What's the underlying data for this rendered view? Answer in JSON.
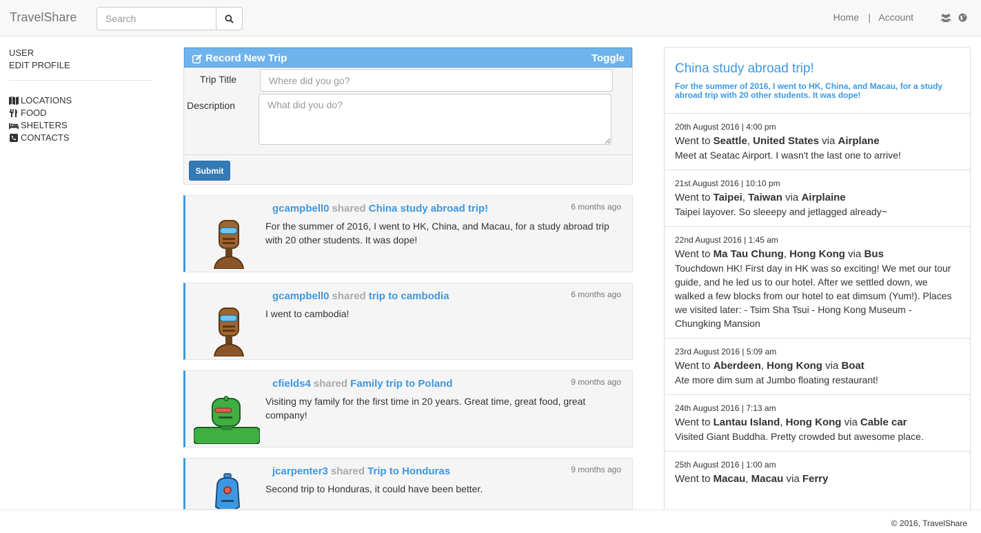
{
  "navbar": {
    "brand": "TravelShare",
    "search_placeholder": "Search",
    "home_label": "Home",
    "separator": "|",
    "account_label": "Account",
    "icons": [
      "users-icon",
      "globe-icon"
    ]
  },
  "sidebar": {
    "top_items": [
      {
        "label": "USER"
      },
      {
        "label": "EDIT PROFILE"
      }
    ],
    "items": [
      {
        "label": "LOCATIONS",
        "icon": "map-icon"
      },
      {
        "label": "FOOD",
        "icon": "cutlery-icon"
      },
      {
        "label": "SHELTERS",
        "icon": "bed-icon"
      },
      {
        "label": "CONTACTS",
        "icon": "phone-icon"
      }
    ]
  },
  "record": {
    "title": "Record New Trip",
    "toggle_label": "Toggle",
    "trip_title_label": "Trip Title",
    "trip_title_placeholder": "Where did you go?",
    "description_label": "Description",
    "description_placeholder": "What did you do?",
    "submit_label": "Submit"
  },
  "feed": [
    {
      "user": "gcampbell0",
      "shared": "shared",
      "trip": "China study abroad trip!",
      "time": "6 months ago",
      "desc": "For the summer of 2016, I went to HK, China, and Macau, for a study abroad trip with 20 other students. It was dope!",
      "avatar": "brown-robot-avatar"
    },
    {
      "user": "gcampbell0",
      "shared": "shared",
      "trip": "trip to cambodia",
      "time": "6 months ago",
      "desc": "I went to cambodia!",
      "avatar": "brown-robot-avatar"
    },
    {
      "user": "cfields4",
      "shared": "shared",
      "trip": "Family trip to Poland",
      "time": "9 months ago",
      "desc": "Visiting my family for the first time in 20 years. Great time, great food, great company!",
      "avatar": "green-robot-avatar"
    },
    {
      "user": "jcarpenter3",
      "shared": "shared",
      "trip": "Trip to Honduras",
      "time": "9 months ago",
      "desc": "Second trip to Honduras, it could have been better.",
      "avatar": "blue-robot-avatar"
    }
  ],
  "trip_detail": {
    "title": "China study abroad trip!",
    "subtitle": "For the summer of 2016, I went to HK, China, and Macau, for a study abroad trip with 20 other students. It was dope!",
    "went_to": "Went to",
    "via": "via",
    "stops": [
      {
        "date": "20th August 2016",
        "time": "4:00 pm",
        "city": "Seattle",
        "country": "United States",
        "transport": "Airplane",
        "desc": "Meet at Seatac Airport. I wasn't the last one to arrive!"
      },
      {
        "date": "21st August 2016",
        "time": "10:10 pm",
        "city": "Taipei",
        "country": "Taiwan",
        "transport": "Airplaine",
        "desc": "Taipei layover. So sleeepy and jetlagged already~"
      },
      {
        "date": "22nd August 2016",
        "time": "1:45 am",
        "city": "Ma Tau Chung",
        "country": "Hong Kong",
        "transport": "Bus",
        "desc": "Touchdown HK! First day in HK was so exciting! We met our tour guide, and he led us to our hotel. After we settled down, we walked a few blocks from our hotel to eat dimsum (Yum!). Places we visited later: - Tsim Sha Tsui - Hong Kong Museum - Chungking Mansion"
      },
      {
        "date": "23rd August 2016",
        "time": "5:09 am",
        "city": "Aberdeen",
        "country": "Hong Kong",
        "transport": "Boat",
        "desc": "Ate more dim sum at Jumbo floating restaurant!"
      },
      {
        "date": "24th August 2016",
        "time": "7:13 am",
        "city": "Lantau Island",
        "country": "Hong Kong",
        "transport": "Cable car",
        "desc": "Visited Giant Buddha. Pretty crowded but awesome place."
      },
      {
        "date": "25th August 2016",
        "time": "1:00 am",
        "city": "Macau",
        "country": "Macau",
        "transport": "Ferry",
        "desc": ""
      }
    ]
  },
  "footer": {
    "text": "© 2016, TravelShare"
  }
}
